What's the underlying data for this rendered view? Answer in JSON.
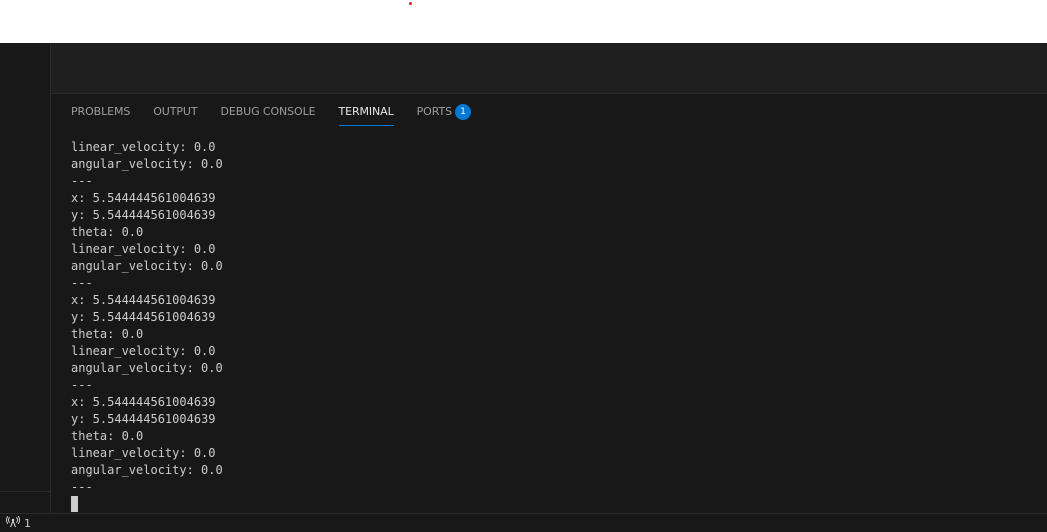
{
  "panel": {
    "tabs": [
      {
        "label": "PROBLEMS"
      },
      {
        "label": "OUTPUT"
      },
      {
        "label": "DEBUG CONSOLE"
      },
      {
        "label": "TERMINAL"
      },
      {
        "label": "PORTS"
      }
    ],
    "active_tab": "TERMINAL",
    "ports_badge": "1"
  },
  "terminal": {
    "lines": [
      "linear_velocity: 0.0",
      "angular_velocity: 0.0",
      "---",
      "x: 5.544444561004639",
      "y: 5.544444561004639",
      "theta: 0.0",
      "linear_velocity: 0.0",
      "angular_velocity: 0.0",
      "---",
      "x: 5.544444561004639",
      "y: 5.544444561004639",
      "theta: 0.0",
      "linear_velocity: 0.0",
      "angular_velocity: 0.0",
      "---",
      "x: 5.544444561004639",
      "y: 5.544444561004639",
      "theta: 0.0",
      "linear_velocity: 0.0",
      "angular_velocity: 0.0",
      "---"
    ]
  },
  "status_bar": {
    "ports_icon": "broadcast-icon",
    "ports_count": "1"
  },
  "colors": {
    "accent": "#0078d4",
    "background": "#181818",
    "indicator_dot": "#e02020"
  }
}
